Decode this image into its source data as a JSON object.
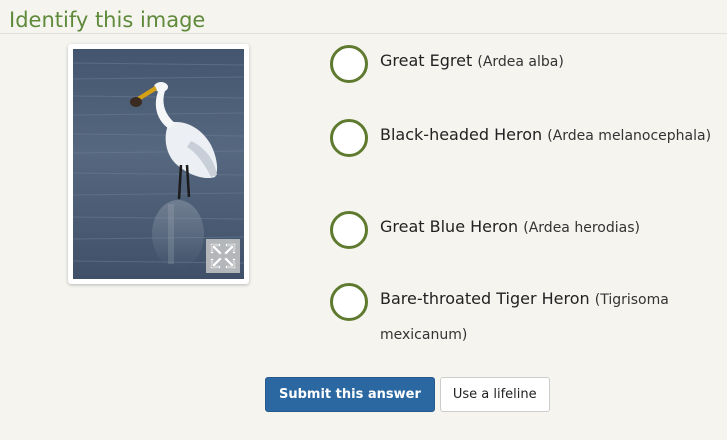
{
  "header": {
    "title": "Identify this image"
  },
  "options": [
    {
      "common": "Great Egret",
      "scientific": "Ardea alba"
    },
    {
      "common": "Black-headed Heron",
      "scientific": "Ardea melanocephala"
    },
    {
      "common": "Great Blue Heron",
      "scientific": "Ardea herodias"
    },
    {
      "common": "Bare-throated Tiger Heron",
      "scientific": "Tigrisoma mexicanum"
    }
  ],
  "buttons": {
    "submit_label": "Submit this answer",
    "lifeline_label": "Use a lifeline"
  },
  "icons": {
    "expand": "expand-icon"
  },
  "colors": {
    "title": "#5e8a3a",
    "radio_border": "#5e7a2e",
    "primary_button": "#2b67a0"
  }
}
